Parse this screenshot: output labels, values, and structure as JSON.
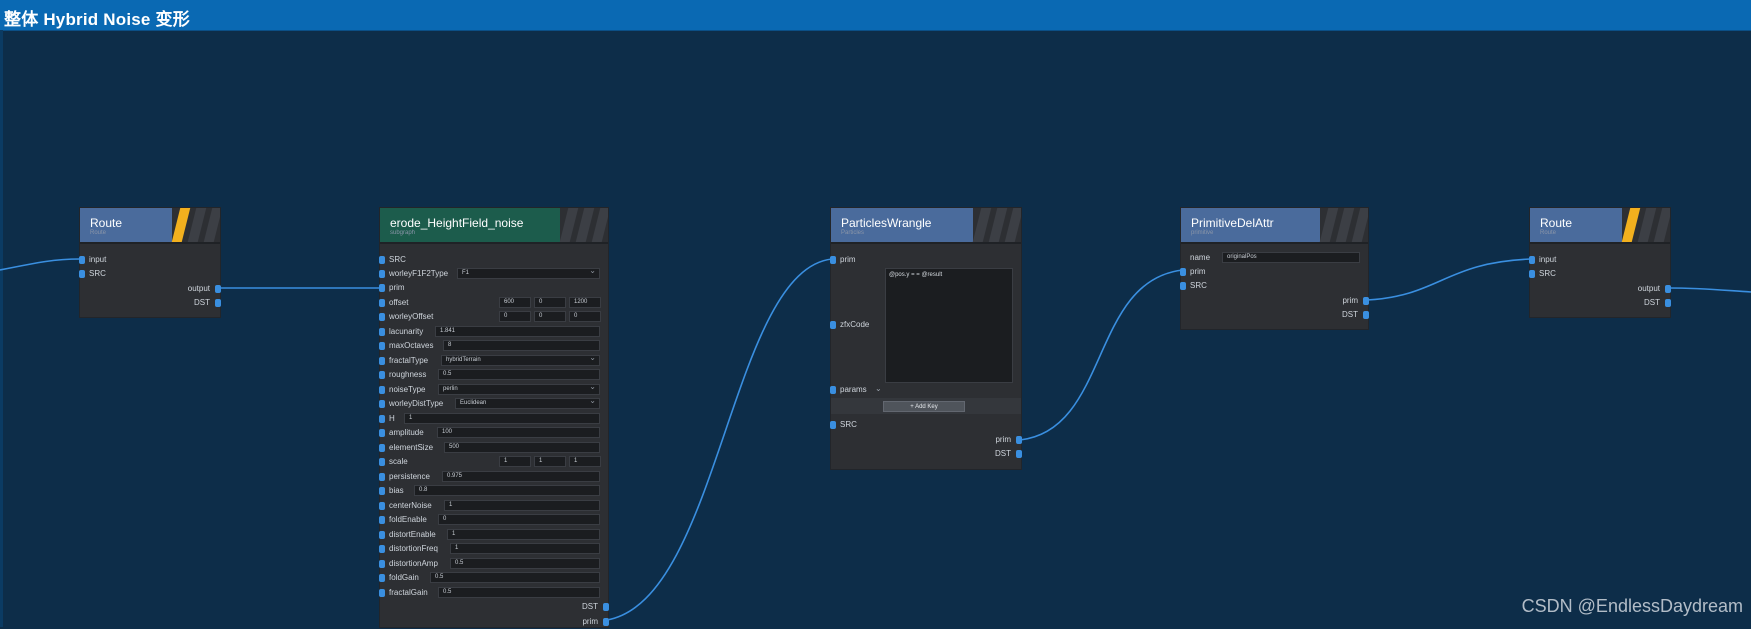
{
  "window": {
    "title": "整体 Hybrid Noise 变形"
  },
  "watermark": "CSDN @EndlessDaydream",
  "colors": {
    "canvas": "#0d2d49",
    "titlebar": "#0a69b3",
    "wire": "#3a8fe0",
    "port": "#3a8fe0",
    "node_body": "#2d2f33",
    "header_blue": "#4a6b9c",
    "header_green": "#1c5c4c",
    "accent_yellow": "#f2b01e"
  },
  "nodes": {
    "route1": {
      "name": "Route",
      "subtitle": "Route",
      "inputs": [
        "input",
        "SRC"
      ],
      "outputs": [
        "output",
        "DST"
      ]
    },
    "erode": {
      "name": "erode_HeightField_noise",
      "subtitle": "subgraph",
      "src": "SRC",
      "params": {
        "worleyF1F2Type": {
          "label": "worleyF1F2Type",
          "value": "F1"
        },
        "prim": "prim",
        "offset": {
          "label": "offset",
          "values": [
            "600",
            "0",
            "1200"
          ]
        },
        "worleyOffset": {
          "label": "worleyOffset",
          "values": [
            "0",
            "0",
            "0"
          ]
        },
        "lacunarity": {
          "label": "lacunarity",
          "value": "1.841"
        },
        "maxOctaves": {
          "label": "maxOctaves",
          "value": "8"
        },
        "fractalType": {
          "label": "fractalType",
          "value": "hybridTerrain"
        },
        "roughness": {
          "label": "roughness",
          "value": "0.5"
        },
        "noiseType": {
          "label": "noiseType",
          "value": "perlin"
        },
        "worleyDistType": {
          "label": "worleyDistType",
          "value": "Euclidean"
        },
        "H": {
          "label": "H",
          "value": "1"
        },
        "amplitude": {
          "label": "amplitude",
          "value": "100"
        },
        "elementSize": {
          "label": "elementSize",
          "value": "500"
        },
        "scale": {
          "label": "scale",
          "values": [
            "1",
            "1",
            "1"
          ]
        },
        "persistence": {
          "label": "persistence",
          "value": "0.975"
        },
        "bias": {
          "label": "bias",
          "value": "0.8"
        },
        "centerNoise": {
          "label": "centerNoise",
          "value": "1"
        },
        "foldEnable": {
          "label": "foldEnable",
          "value": "0"
        },
        "distortEnable": {
          "label": "distortEnable",
          "value": "1"
        },
        "distortionFreq": {
          "label": "distortionFreq",
          "value": "1"
        },
        "distortionAmp": {
          "label": "distortionAmp",
          "value": "0.5"
        },
        "foldGain": {
          "label": "foldGain",
          "value": "0.5"
        },
        "fractalGain": {
          "label": "fractalGain",
          "value": "0.5"
        }
      },
      "outputs": [
        "DST",
        "prim"
      ]
    },
    "wrangle": {
      "name": "ParticlesWrangle",
      "subtitle": "Particles",
      "inputs": {
        "prim": "prim",
        "zfxCode": "zfxCode",
        "params": "params",
        "SRC": "SRC"
      },
      "code": "@pos.y = = @result",
      "add_key": "+ Add Key",
      "outputs": [
        "prim",
        "DST"
      ]
    },
    "delattr": {
      "name": "PrimitiveDelAttr",
      "subtitle": "primitive",
      "name_field": {
        "label": "name",
        "value": "originalPos"
      },
      "inputs": [
        "prim",
        "SRC"
      ],
      "outputs": [
        "prim",
        "DST"
      ]
    },
    "route2": {
      "name": "Route",
      "subtitle": "Route",
      "inputs": [
        "input",
        "SRC"
      ],
      "outputs": [
        "output",
        "DST"
      ]
    }
  }
}
